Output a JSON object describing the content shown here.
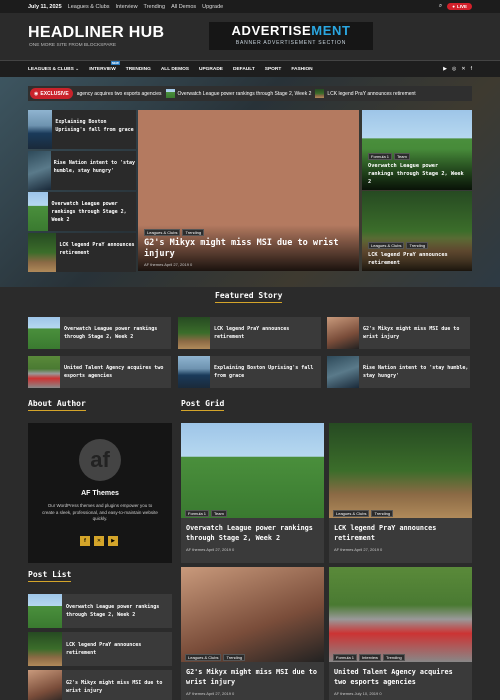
{
  "topbar": {
    "date": "July 11, 2025",
    "links": [
      "Leagues & Clubs",
      "Interview",
      "Trending",
      "All Demos",
      "Upgrade"
    ],
    "live": "LIVE"
  },
  "header": {
    "logo": "HEADLINER HUB",
    "tagline": "ONE MORE SITE FROM BLOCKSPARE",
    "ad_title_a": "ADVERTISE",
    "ad_title_b": "MENT",
    "ad_sub": "BANNER ADVERTISEMENT SECTION"
  },
  "nav": {
    "items": [
      "LEAGUES & CLUBS ⌄",
      "INTERVIEW",
      "TRENDING",
      "ALL DEMOS",
      "UPGRADE",
      "DEFAULT",
      "SPORT",
      "FASHION"
    ],
    "new_badge": "NEW"
  },
  "ticker": {
    "label": "EXCLUSIVE",
    "items": [
      "agency acquires two esports agencies",
      "Overwatch League power rankings through Stage 2, Week 2",
      "LCK legend PraY announces retirement"
    ]
  },
  "hero": {
    "list": [
      "Explaining Boston Uprising's fall from grace",
      "Rise Nation intent to 'stay humble, stay hungry'",
      "Overwatch League power rankings through Stage 2, Week 2",
      "LCK legend PraY announces retirement"
    ],
    "main": {
      "tags": [
        "Leagues & Clubs",
        "Trending"
      ],
      "title": "G2's Mikyx might miss MSI due to wrist injury",
      "meta": "AF themes   April 27, 2019   0"
    },
    "side": [
      {
        "tags": [
          "Formula 1",
          "Team"
        ],
        "title": "Overwatch League power rankings through Stage 2, Week 2"
      },
      {
        "tags": [
          "Leagues & Clubs",
          "Trending"
        ],
        "title": "LCK legend PraY announces retirement"
      }
    ]
  },
  "featured": {
    "title": "Featured Story",
    "items": [
      "Overwatch League power rankings through Stage 2, Week 2",
      "LCK legend PraY announces retirement",
      "G2's Mikyx might miss MSI due to wrist injury",
      "United Talent Agency acquires two esports agencies",
      "Explaining Boston Uprising's fall from grace",
      "Rise Nation intent to 'stay humble, stay hungry'"
    ]
  },
  "about": {
    "title": "About Author",
    "name": "AF Themes",
    "desc": "Our WordPress themes and plugins empower you to create a sleek, professional, and easy-to-maintain website quickly.",
    "avatar": "af"
  },
  "grid": {
    "title": "Post Grid",
    "cards": [
      {
        "tags": [
          "Formula 1",
          "Team"
        ],
        "title": "Overwatch League power rankings through Stage 2, Week 2",
        "meta": "AF themes   April 27, 2019   0"
      },
      {
        "tags": [
          "Leagues & Clubs",
          "Trending"
        ],
        "title": "LCK legend PraY announces retirement",
        "meta": "AF themes   April 27, 2019   0"
      },
      {
        "tags": [
          "Leagues & Clubs",
          "Trending"
        ],
        "title": "G2's Mikyx might miss MSI due to wrist injury",
        "meta": "AF themes   April 27, 2019   0"
      },
      {
        "tags": [
          "Formula 1",
          "Interview",
          "Trending"
        ],
        "title": "United Talent Agency acquires two esports agencies",
        "meta": "AF themes   July 10, 2019   0"
      }
    ]
  },
  "postlist": {
    "title": "Post List",
    "items": [
      "Overwatch League power rankings through Stage 2, Week 2",
      "LCK legend PraY announces retirement",
      "G2's Mikyx might miss MSI due to wrist injury"
    ]
  },
  "colors": {
    "accent": "#d4a52a",
    "live": "#d3202a",
    "ad_blue": "#2aa6e0"
  }
}
